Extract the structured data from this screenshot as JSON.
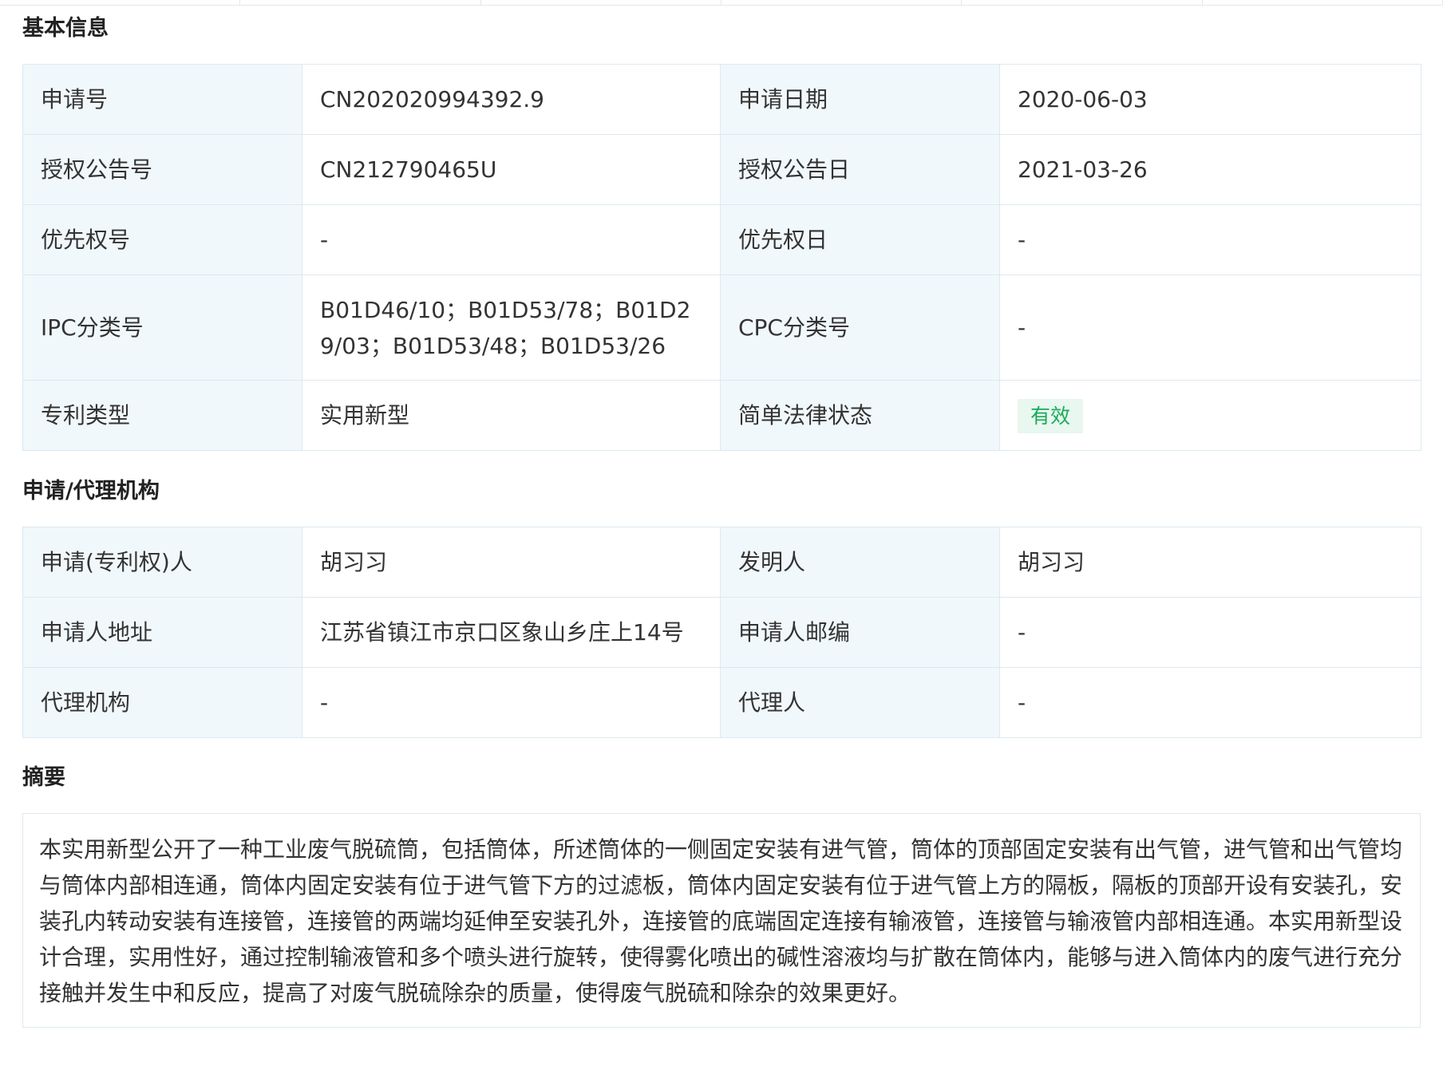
{
  "sections": {
    "basic": "基本信息",
    "agency": "申请/代理机构",
    "abstract": "摘要"
  },
  "basic_info": {
    "app_no_label": "申请号",
    "app_no": "CN202020994392.9",
    "app_date_label": "申请日期",
    "app_date": "2020-06-03",
    "grant_no_label": "授权公告号",
    "grant_no": "CN212790465U",
    "grant_date_label": "授权公告日",
    "grant_date": "2021-03-26",
    "priority_no_label": "优先权号",
    "priority_no": "-",
    "priority_date_label": "优先权日",
    "priority_date": "-",
    "ipc_label": "IPC分类号",
    "ipc": "B01D46/10；B01D53/78；B01D29/03；B01D53/48；B01D53/26",
    "cpc_label": "CPC分类号",
    "cpc": "-",
    "type_label": "专利类型",
    "type": "实用新型",
    "status_label": "简单法律状态",
    "status": "有效"
  },
  "agency_info": {
    "applicant_label": "申请(专利权)人",
    "applicant": "胡习习",
    "inventor_label": "发明人",
    "inventor": "胡习习",
    "address_label": "申请人地址",
    "address": "江苏省镇江市京口区象山乡庄上14号",
    "postcode_label": "申请人邮编",
    "postcode": "-",
    "agency_label": "代理机构",
    "agency": "-",
    "agent_label": "代理人",
    "agent": "-"
  },
  "abstract_text": "本实用新型公开了一种工业废气脱硫筒，包括筒体，所述筒体的一侧固定安装有进气管，筒体的顶部固定安装有出气管，进气管和出气管均与筒体内部相连通，筒体内固定安装有位于进气管下方的过滤板，筒体内固定安装有位于进气管上方的隔板，隔板的顶部开设有安装孔，安装孔内转动安装有连接管，连接管的两端均延伸至安装孔外，连接管的底端固定连接有输液管，连接管与输液管内部相连通。本实用新型设计合理，实用性好，通过控制输液管和多个喷头进行旋转，使得雾化喷出的碱性溶液均与扩散在筒体内，能够与进入筒体内的废气进行充分接触并发生中和反应，提高了对废气脱硫除杂的质量，使得废气脱硫和除杂的效果更好。",
  "colors": {
    "label_bg": "#f1f8fb",
    "border": "#dde8ef",
    "status_green": "#1aab5b",
    "status_bg": "#e8f7ef"
  }
}
